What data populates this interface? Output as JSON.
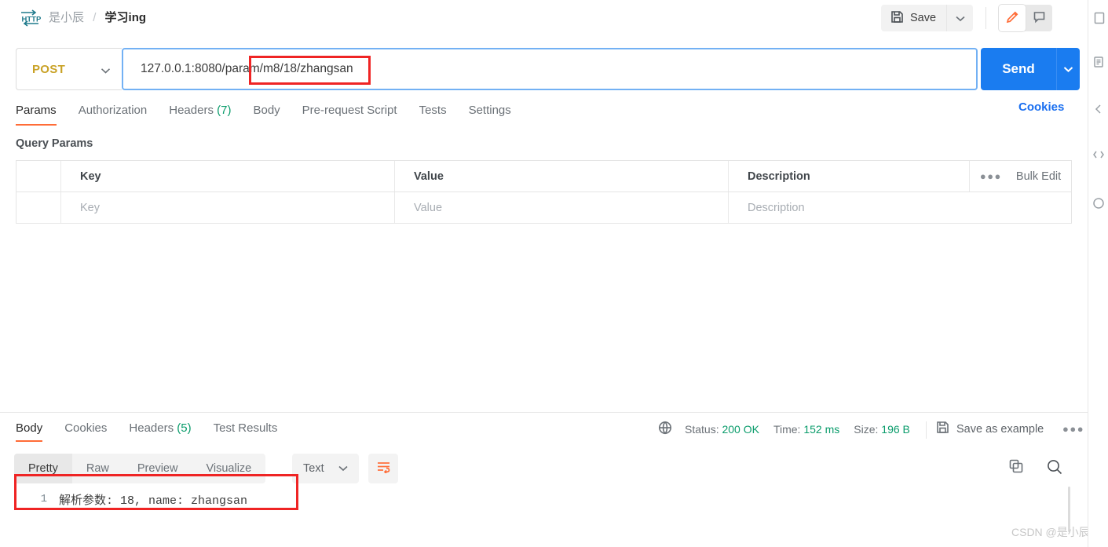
{
  "header": {
    "logo_icon": "http-protocol-icon",
    "breadcrumb": {
      "owner": "是小辰",
      "separator": "/",
      "name": "学习ing"
    },
    "save_label": "Save",
    "save_icon": "floppy-disk-icon",
    "save_caret_icon": "chevron-down-icon",
    "edit_icon": "pencil-icon",
    "comment_icon": "comment-icon"
  },
  "request": {
    "method": "POST",
    "method_caret_icon": "chevron-down-icon",
    "url": "127.0.0.1:8080/param/m8/18/zhangsan",
    "send_label": "Send",
    "send_caret_icon": "chevron-down-icon"
  },
  "request_tabs": [
    {
      "label": "Params",
      "count": "",
      "active": true
    },
    {
      "label": "Authorization",
      "count": "",
      "active": false
    },
    {
      "label": "Headers",
      "count": "(7)",
      "active": false
    },
    {
      "label": "Body",
      "count": "",
      "active": false
    },
    {
      "label": "Pre-request Script",
      "count": "",
      "active": false
    },
    {
      "label": "Tests",
      "count": "",
      "active": false
    },
    {
      "label": "Settings",
      "count": "",
      "active": false
    }
  ],
  "cookies_link": "Cookies",
  "query_params": {
    "title": "Query Params",
    "headers": {
      "key": "Key",
      "value": "Value",
      "description": "Description"
    },
    "bulk_edit": "Bulk Edit",
    "more_icon": "ellipsis-icon",
    "rows": [
      {
        "key": "Key",
        "value": "Value",
        "description": "Description"
      }
    ]
  },
  "response_tabs": [
    {
      "label": "Body",
      "count": "",
      "active": true
    },
    {
      "label": "Cookies",
      "count": "",
      "active": false
    },
    {
      "label": "Headers",
      "count": "(5)",
      "active": false
    },
    {
      "label": "Test Results",
      "count": "",
      "active": false
    }
  ],
  "status_bar": {
    "globe_icon": "globe-icon",
    "status_label": "Status:",
    "status_value": "200 OK",
    "time_label": "Time:",
    "time_value": "152 ms",
    "size_label": "Size:",
    "size_value": "196 B",
    "save_example_label": "Save as example",
    "save_example_icon": "floppy-disk-icon",
    "more_icon": "ellipsis-icon"
  },
  "viewer": {
    "tabs": [
      {
        "label": "Pretty",
        "active": true
      },
      {
        "label": "Raw",
        "active": false
      },
      {
        "label": "Preview",
        "active": false
      },
      {
        "label": "Visualize",
        "active": false
      }
    ],
    "format": "Text",
    "format_caret_icon": "chevron-down-icon",
    "wrap_icon": "wrap-text-icon",
    "copy_icon": "copy-icon",
    "search_icon": "search-icon"
  },
  "response_body": {
    "line_number": "1",
    "line_text": "解析参数: 18, name: zhangsan"
  },
  "right_rail": [
    {
      "icon": "layout-panel-icon"
    },
    {
      "icon": "documentation-icon"
    },
    {
      "icon": "chevron-left-icon"
    },
    {
      "icon": "code-snippet-icon"
    },
    {
      "icon": "info-circle-icon"
    }
  ],
  "watermark": "CSDN @是小辰",
  "colors": {
    "accent_orange": "#ff6c37",
    "send_blue": "#1a7cf0",
    "focus_blue": "#73b1f4",
    "method_post": "#c9a227",
    "status_green": "#0a9c6b",
    "annotation_red": "#ef2424",
    "link_blue": "#1a6ff0"
  }
}
